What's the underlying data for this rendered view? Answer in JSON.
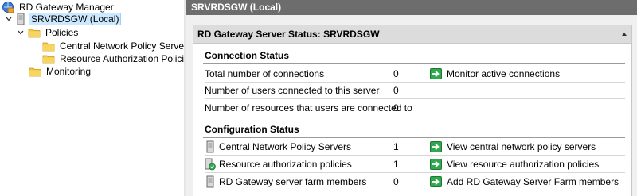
{
  "tree": {
    "root": "RD Gateway Manager",
    "server": "SRVRDSGW (Local)",
    "policies": "Policies",
    "cnps": "Central Network Policy Servers",
    "rap": "Resource Authorization Policies",
    "monitoring": "Monitoring"
  },
  "pane": {
    "header": "SRVRDSGW (Local)",
    "panel_title": "RD Gateway Server Status: SRVRDSGW",
    "connection": {
      "title": "Connection Status",
      "rows": [
        {
          "label": "Total number of connections",
          "value": "0",
          "action": "Monitor active connections"
        },
        {
          "label": "Number of users connected to this server",
          "value": "0"
        },
        {
          "label": "Number of resources that users are connected to",
          "value": "0"
        }
      ]
    },
    "configuration": {
      "title": "Configuration Status",
      "rows": [
        {
          "label": "Central Network Policy Servers",
          "value": "1",
          "action": "View central network policy servers"
        },
        {
          "label": "Resource authorization policies",
          "value": "1",
          "action": "View resource authorization policies"
        },
        {
          "label": "RD Gateway server farm members",
          "value": "0",
          "action": "Add RD Gateway Server Farm members"
        }
      ]
    }
  },
  "colors": {
    "accent_green": "#2fa84f",
    "folder": "#f3c641",
    "header_bg": "#6d6d6d",
    "selection": "#cce8ff"
  },
  "icons": [
    "gateway-manager-icon",
    "server-icon",
    "folder-icon",
    "green-arrow-icon",
    "policy-check-icon",
    "chevron-down-icon",
    "collapse-icon"
  ]
}
